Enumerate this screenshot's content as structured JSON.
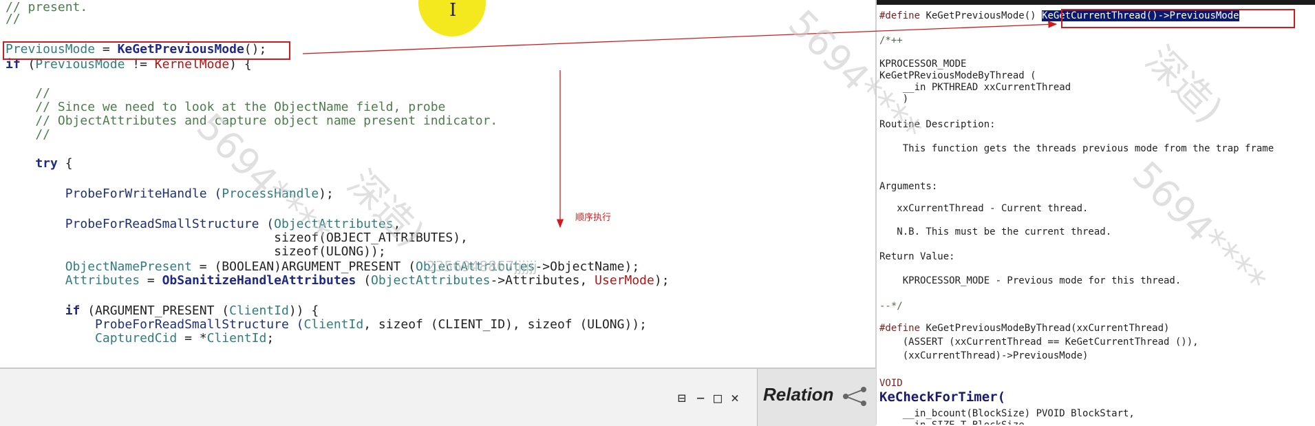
{
  "left_code": {
    "lines": [
      {
        "parts": [
          {
            "t": "// present.",
            "c": "cm"
          }
        ]
      },
      {
        "parts": [
          {
            "t": "//",
            "c": "cm"
          }
        ]
      },
      {
        "parts": [
          {
            "t": "PreviousMode",
            "c": "vr"
          },
          {
            "t": " = ",
            "c": ""
          },
          {
            "t": "KeGetPreviousMode",
            "c": "kw"
          },
          {
            "t": "();",
            "c": ""
          }
        ]
      },
      {
        "parts": [
          {
            "t": "if",
            "c": "kw"
          },
          {
            "t": " (",
            "c": ""
          },
          {
            "t": "PreviousMode",
            "c": "vr"
          },
          {
            "t": " != ",
            "c": ""
          },
          {
            "t": "KernelMode",
            "c": "rd"
          },
          {
            "t": ") {",
            "c": ""
          }
        ]
      },
      {
        "parts": [
          {
            "t": "    //",
            "c": "cm"
          }
        ]
      },
      {
        "parts": [
          {
            "t": "    // Since we need to look at the ObjectName field, probe",
            "c": "cm"
          }
        ]
      },
      {
        "parts": [
          {
            "t": "    // ObjectAttributes and capture object name present indicator.",
            "c": "cm"
          }
        ]
      },
      {
        "parts": [
          {
            "t": "    //",
            "c": "cm"
          }
        ]
      },
      {
        "parts": [
          {
            "t": "    try",
            "c": "kw"
          },
          {
            "t": " {",
            "c": ""
          }
        ]
      },
      {
        "parts": [
          {
            "t": "        ProbeForWriteHandle (",
            "c": "fn"
          },
          {
            "t": "ProcessHandle",
            "c": "vr"
          },
          {
            "t": ");",
            "c": ""
          }
        ]
      },
      {
        "parts": [
          {
            "t": "        ProbeForReadSmallStructure (",
            "c": "fn"
          },
          {
            "t": "ObjectAttributes",
            "c": "vr"
          },
          {
            "t": ",",
            "c": ""
          }
        ]
      },
      {
        "parts": [
          {
            "t": "                                    sizeof(OBJECT_ATTRIBUTES),",
            "c": ""
          }
        ]
      },
      {
        "parts": [
          {
            "t": "                                    sizeof(ULONG));",
            "c": ""
          }
        ]
      },
      {
        "parts": [
          {
            "t": "        ObjectNamePresent",
            "c": "vr"
          },
          {
            "t": " = (BOOLEAN)ARGUMENT_PRESENT (",
            "c": ""
          },
          {
            "t": "ObjectAttributes",
            "c": "vr"
          },
          {
            "t": "->ObjectName);",
            "c": ""
          }
        ]
      },
      {
        "parts": [
          {
            "t": "        Attributes",
            "c": "vr"
          },
          {
            "t": " = ",
            "c": ""
          },
          {
            "t": "ObSanitizeHandleAttributes",
            "c": "kw"
          },
          {
            "t": " (",
            "c": ""
          },
          {
            "t": "ObjectAttributes",
            "c": "vr"
          },
          {
            "t": "->Attributes, ",
            "c": ""
          },
          {
            "t": "UserMode",
            "c": "rd"
          },
          {
            "t": ");",
            "c": ""
          }
        ]
      },
      {
        "parts": [
          {
            "t": "        if",
            "c": "kw"
          },
          {
            "t": " (ARGUMENT_PRESENT (",
            "c": ""
          },
          {
            "t": "ClientId",
            "c": "vr"
          },
          {
            "t": ")) {",
            "c": ""
          }
        ]
      },
      {
        "parts": [
          {
            "t": "            ProbeForReadSmallStructure (",
            "c": "fn"
          },
          {
            "t": "ClientId",
            "c": "vr"
          },
          {
            "t": ", sizeof (CLIENT_ID), sizeof (ULONG));",
            "c": ""
          }
        ]
      },
      {
        "parts": [
          {
            "t": "            CapturedCid",
            "c": "vr"
          },
          {
            "t": " = *",
            "c": ""
          },
          {
            "t": "ClientId",
            "c": "vr"
          },
          {
            "t": ";",
            "c": ""
          }
        ]
      }
    ]
  },
  "right_code": {
    "lines": [
      {
        "parts": [
          {
            "t": "#define ",
            "c": "rkw"
          },
          {
            "t": "KeGetPreviousMode() ",
            "c": ""
          },
          {
            "t": "KeGetCurrentThread()->PreviousMode",
            "c": "sel"
          }
        ]
      },
      {
        "parts": [
          {
            "t": "/*++",
            "c": "rcm"
          }
        ]
      },
      {
        "parts": [
          {
            "t": "KPROCESSOR_MODE",
            "c": ""
          }
        ]
      },
      {
        "parts": [
          {
            "t": "KeGetPReviousModeByThread (",
            "c": ""
          }
        ]
      },
      {
        "parts": [
          {
            "t": "    __in PKTHREAD xxCurrentThread",
            "c": ""
          }
        ]
      },
      {
        "parts": [
          {
            "t": "    )",
            "c": ""
          }
        ]
      },
      {
        "parts": [
          {
            "t": "Routine Description:",
            "c": ""
          }
        ]
      },
      {
        "parts": [
          {
            "t": "    This function gets the threads previous mode from the trap frame",
            "c": ""
          }
        ]
      },
      {
        "parts": [
          {
            "t": "Arguments:",
            "c": ""
          }
        ]
      },
      {
        "parts": [
          {
            "t": "   xxCurrentThread - Current thread.",
            "c": ""
          }
        ]
      },
      {
        "parts": [
          {
            "t": "   N.B. This must be the current thread.",
            "c": ""
          }
        ]
      },
      {
        "parts": [
          {
            "t": "Return Value:",
            "c": ""
          }
        ]
      },
      {
        "parts": [
          {
            "t": "    KPROCESSOR_MODE - Previous mode for this thread.",
            "c": ""
          }
        ]
      },
      {
        "parts": [
          {
            "t": "--*/",
            "c": "rcm"
          }
        ]
      },
      {
        "parts": [
          {
            "t": "#define ",
            "c": "rkw"
          },
          {
            "t": "KeGetPreviousModeByThread(xxCurrentThread)",
            "c": ""
          }
        ]
      },
      {
        "parts": [
          {
            "t": "    (ASSERT (xxCurrentThread == KeGetCurrentThread ()),",
            "c": ""
          }
        ]
      },
      {
        "parts": [
          {
            "t": "    (xxCurrentThread)->PreviousMode)",
            "c": ""
          }
        ]
      },
      {
        "parts": [
          {
            "t": "VOID",
            "c": "rkw"
          }
        ]
      },
      {
        "parts": [
          {
            "t": "KeCheckForTimer(",
            "c": "rfn"
          }
        ]
      },
      {
        "parts": [
          {
            "t": "    __in_bcount(BlockSize) PVOID BlockStart,",
            "c": ""
          }
        ]
      },
      {
        "parts": [
          {
            "t": "    __in SIZE_T BlockSize",
            "c": ""
          }
        ]
      }
    ]
  },
  "annotation": {
    "label": "顺序执行"
  },
  "bottom_bar": {
    "relation_label": "Relation",
    "pin_glyph": "⊟",
    "minimize_glyph": "−",
    "maximize_glyph": "□",
    "close_glyph": "×"
  },
  "watermark": {
    "texts": [
      "5694****",
      "深造)",
      "5694****",
      "深造)",
      "5694****",
      "2356948867jjjjjj"
    ]
  },
  "colors": {
    "annotation_red": "#d21a1a",
    "selection_bg": "#0b1a6e",
    "highlight_yellow": "#f3e812"
  }
}
